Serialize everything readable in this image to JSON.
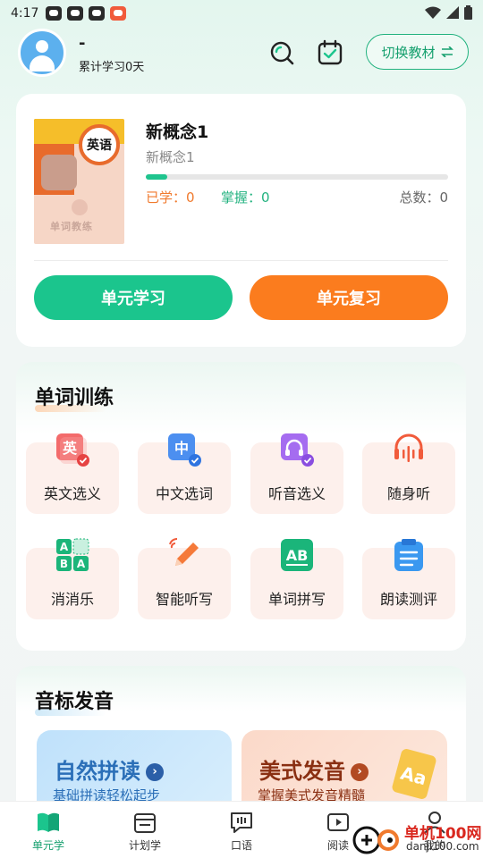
{
  "status": {
    "time": "4:17"
  },
  "header": {
    "user_name": "-",
    "study_days": "累计学习0天",
    "switch_label": "切换教材"
  },
  "book": {
    "cover_badge": "英语",
    "cover_text": "单词教练",
    "title": "新概念1",
    "subtitle": "新概念1",
    "progress": 0.07,
    "learned": "已学：0",
    "mastered": "掌握：0",
    "total": "总数：0",
    "study_button": "单元学习",
    "review_button": "单元复习"
  },
  "word_training": {
    "title": "单词训练",
    "tiles": [
      {
        "label": "英文选义",
        "icon": "ying-card-icon"
      },
      {
        "label": "中文选词",
        "icon": "zhong-card-icon"
      },
      {
        "label": "听音选义",
        "icon": "headphone-card-icon"
      },
      {
        "label": "随身听",
        "icon": "sound-wave-icon"
      },
      {
        "label": "消消乐",
        "icon": "abba-grid-icon"
      },
      {
        "label": "智能听写",
        "icon": "pencil-icon"
      },
      {
        "label": "单词拼写",
        "icon": "ab-board-icon"
      },
      {
        "label": "朗读测评",
        "icon": "clipboard-icon"
      }
    ]
  },
  "phonetics": {
    "title": "音标发音",
    "cards": [
      {
        "title": "自然拼读",
        "subtitle": "基础拼读轻松起步"
      },
      {
        "title": "美式发音",
        "subtitle": "掌握美式发音精髓"
      }
    ]
  },
  "tabs": [
    {
      "label": "单元学",
      "active": true
    },
    {
      "label": "计划学",
      "active": false
    },
    {
      "label": "口语",
      "active": false
    },
    {
      "label": "阅读",
      "active": false
    },
    {
      "label": "我的",
      "active": false
    }
  ],
  "watermark": {
    "text": "单机100网",
    "url": "danji100.com"
  },
  "colors": {
    "green": "#1bc58d",
    "orange": "#fb7c1e",
    "blue_text": "#2b6fb8",
    "brown_text": "#8a2f12"
  }
}
